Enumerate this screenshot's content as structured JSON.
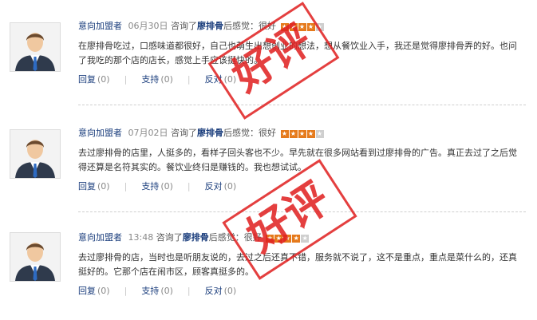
{
  "reviews": [
    {
      "user": "意向加盟者",
      "date": "06月30日",
      "consulted": "咨询了",
      "product": "廖排骨",
      "feeling_prefix": "后感觉：",
      "feeling": "很好",
      "rating": 4,
      "rating_max": 5,
      "text": "在廖排骨吃过，口感味道都很好，自己也萌生出想创业的想法，想从餐饮业入手，我还是觉得廖排骨弄的好。也问了我吃的那个店的店长，感觉上手应该挺快的。",
      "reply_label": "回复",
      "reply_count": "(0)",
      "support_label": "支持",
      "support_count": "(0)",
      "oppose_label": "反对",
      "oppose_count": "(0)"
    },
    {
      "user": "意向加盟者",
      "date": "07月02日",
      "consulted": "咨询了",
      "product": "廖排骨",
      "feeling_prefix": "后感觉：",
      "feeling": "很好",
      "rating": 4,
      "rating_max": 5,
      "text": "去过廖排骨的店里，人挺多的，看样子回头客也不少。早先就在很多网站看到过廖排骨的广告。真正去过了之后觉得还算是名符其实的。餐饮业终归是赚钱的。我也想试试。",
      "reply_label": "回复",
      "reply_count": "(0)",
      "support_label": "支持",
      "support_count": "(0)",
      "oppose_label": "反对",
      "oppose_count": "(0)"
    },
    {
      "user": "意向加盟者",
      "date": "13:48",
      "consulted": "咨询了",
      "product": "廖排骨",
      "feeling_prefix": "后感觉：",
      "feeling": "很好",
      "rating": 4,
      "rating_max": 5,
      "text": "去过廖排骨的店，当时也是听朋友说的，去过之后还真不错，服务就不说了，这不是重点，重点是菜什么的，还真挺好的。它那个店在闹市区，顾客真挺多的。",
      "reply_label": "回复",
      "reply_count": "(0)",
      "support_label": "支持",
      "support_count": "(0)",
      "oppose_label": "反对",
      "oppose_count": "(0)"
    }
  ],
  "stamps": [
    {
      "text": "好评",
      "color": "#e02020"
    },
    {
      "text": "好评",
      "color": "#e02020"
    }
  ]
}
